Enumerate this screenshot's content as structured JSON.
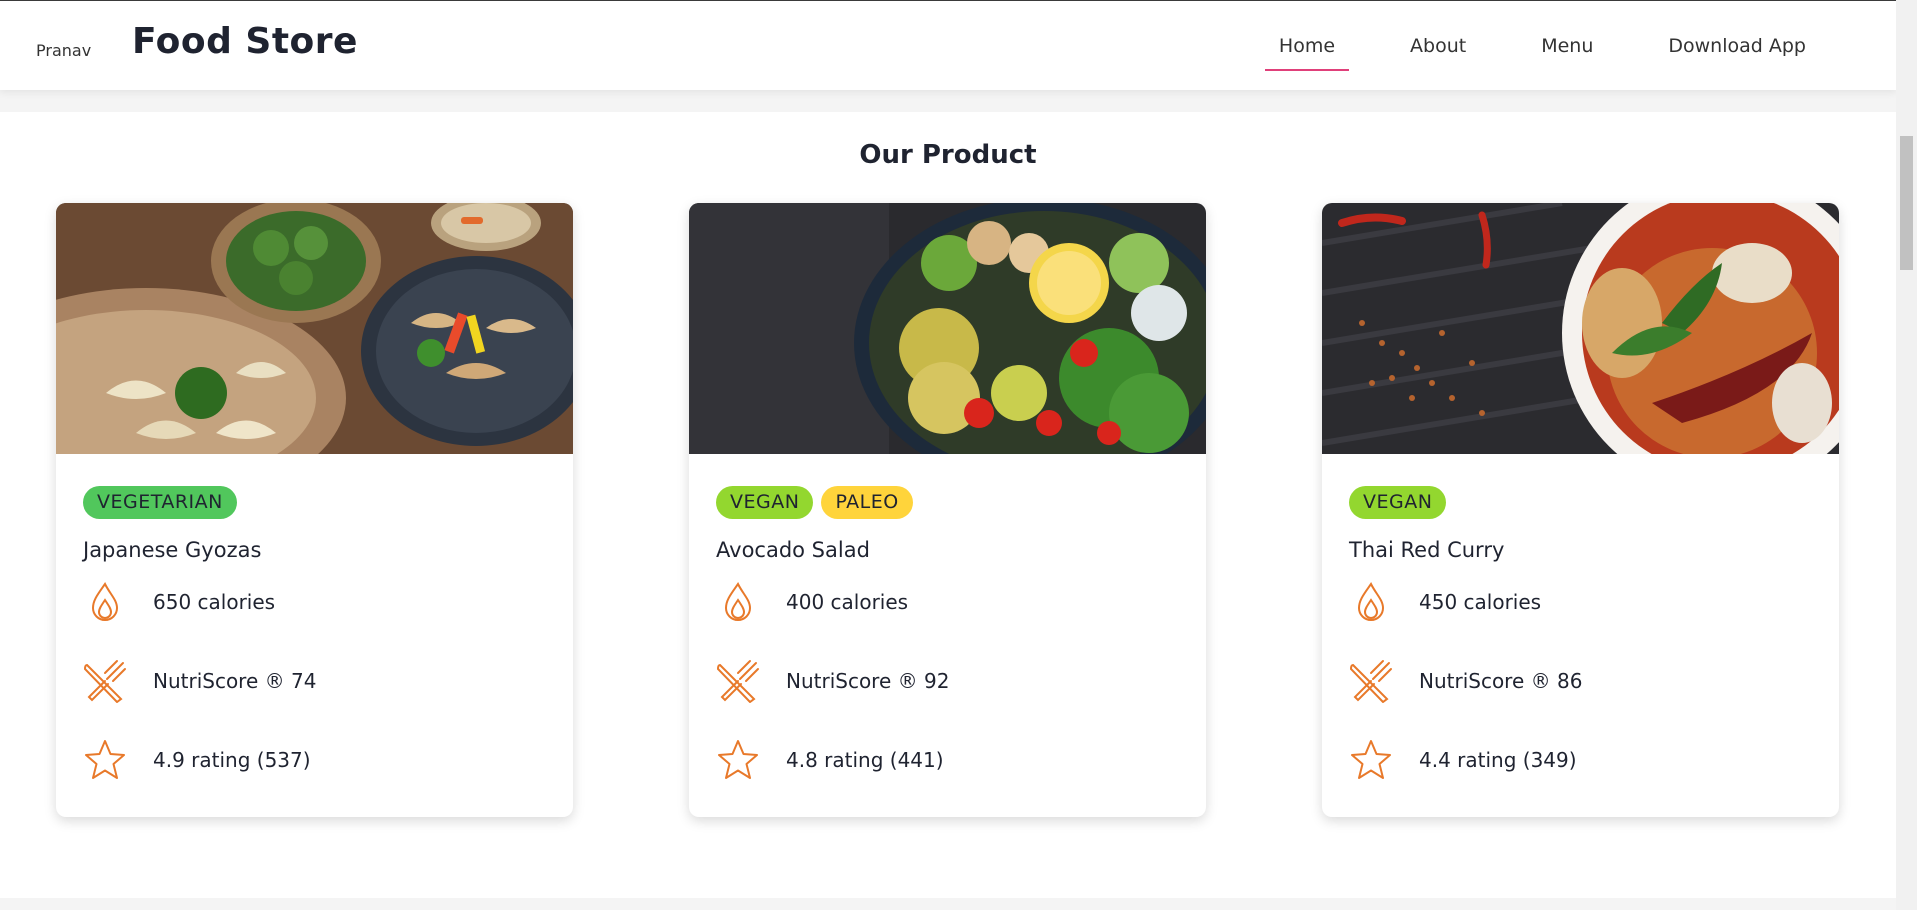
{
  "header": {
    "user": "Pranav",
    "brand": "Food Store",
    "nav": [
      "Home",
      "About",
      "Menu",
      "Download App"
    ]
  },
  "section": {
    "title": "Our Product"
  },
  "products": [
    {
      "name": "Japanese Gyozas",
      "tags": [
        "VEGETARIAN"
      ],
      "calories": "650 calories",
      "nutriscore": "NutriScore ® 74",
      "rating": "4.9 rating (537)"
    },
    {
      "name": "Avocado Salad",
      "tags": [
        "VEGAN",
        "PALEO"
      ],
      "calories": "400 calories",
      "nutriscore": "NutriScore ® 92",
      "rating": "4.8 rating (441)"
    },
    {
      "name": "Thai Red Curry",
      "tags": [
        "VEGAN"
      ],
      "calories": "450 calories",
      "nutriscore": "NutriScore ® 86",
      "rating": "4.4 rating (349)"
    }
  ],
  "colors": {
    "accent": "#e0407a",
    "icon": "#e8792a"
  },
  "icons": {
    "calories": "flame-icon",
    "nutriscore": "fork-knife-icon",
    "rating": "star-icon"
  }
}
